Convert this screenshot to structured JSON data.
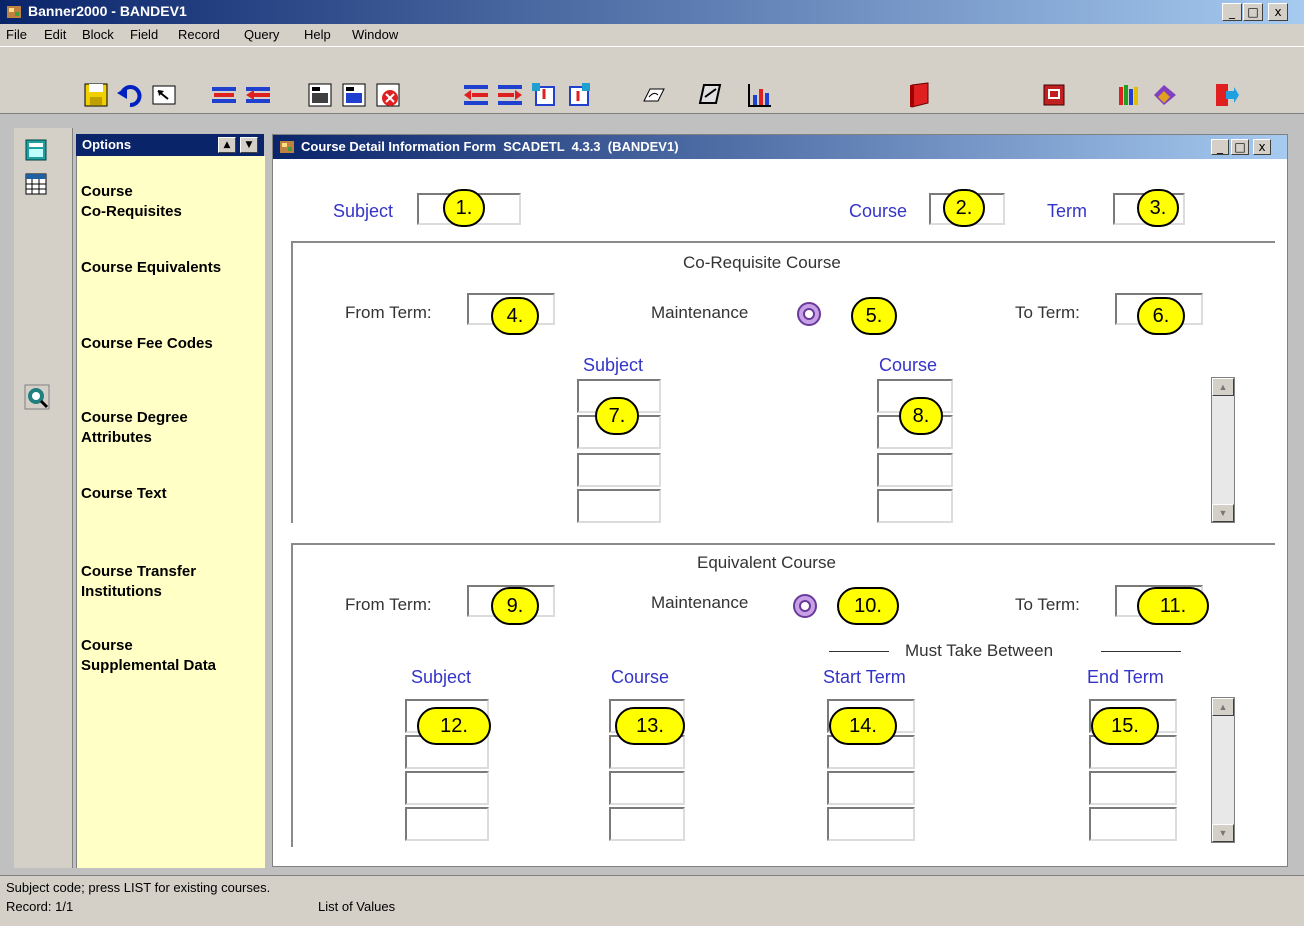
{
  "window": {
    "title": "Banner2000 - BANDEV1",
    "min_glyph": "_",
    "max_glyph": "□",
    "close_glyph": "x"
  },
  "menu": [
    "File",
    "Edit",
    "Block",
    "Field",
    "Record",
    "Query",
    "Help",
    "Window"
  ],
  "toolbar_icons": [
    "save-icon",
    "rollback-icon",
    "select-icon",
    "insert-record-icon",
    "remove-record-icon",
    "enter-query-icon",
    "execute-query-icon",
    "cancel-query-icon",
    "previous-block-icon",
    "next-block-icon",
    "previous-record-icon",
    "next-record-icon",
    "print-icon",
    "export-icon",
    "chart-icon",
    "help-book-icon",
    "calendar-icon",
    "bookshelf-icon",
    "books-icon",
    "exit-icon"
  ],
  "colors": {
    "title_gradient_start": "#0a246a",
    "label_blue": "#3434c8",
    "options_bg": "#ffffc6",
    "badge_yellow": "#ffff00"
  },
  "options": {
    "header": "Options",
    "items": [
      [
        "Course",
        "Co-Requisites"
      ],
      [
        "Course Equivalents"
      ],
      [
        "Course Fee Codes"
      ],
      [
        "Course Degree",
        "Attributes"
      ],
      [
        "Course Text"
      ],
      [
        "Course  Transfer",
        "Institutions"
      ],
      [
        "Course",
        "Supplemental Data"
      ]
    ]
  },
  "form": {
    "title": "Course Detail Information Form  SCADETL  4.3.3  (BANDEV1)",
    "key_block": {
      "subject_label": "Subject",
      "course_label": "Course",
      "term_label": "Term"
    },
    "corequisite": {
      "heading": "Co-Requisite Course",
      "from_term_label": "From Term:",
      "maintenance_label": "Maintenance",
      "to_term_label": "To Term:",
      "subject_col": "Subject",
      "course_col": "Course"
    },
    "equivalent": {
      "heading": "Equivalent Course",
      "from_term_label": "From Term:",
      "maintenance_label": "Maintenance",
      "to_term_label": "To Term:",
      "must_take": "Must Take Between",
      "subject_col": "Subject",
      "course_col": "Course",
      "start_term_col": "Start Term",
      "end_term_col": "End Term"
    },
    "badges": [
      "1.",
      "2.",
      "3.",
      "4.",
      "5.",
      "6.",
      "7.",
      "8.",
      "9.",
      "10.",
      "11.",
      "12.",
      "13.",
      "14.",
      "15."
    ]
  },
  "status": {
    "hint": "Subject code; press LIST for existing courses.",
    "record": "Record: 1/1",
    "lov": "List of Values"
  }
}
